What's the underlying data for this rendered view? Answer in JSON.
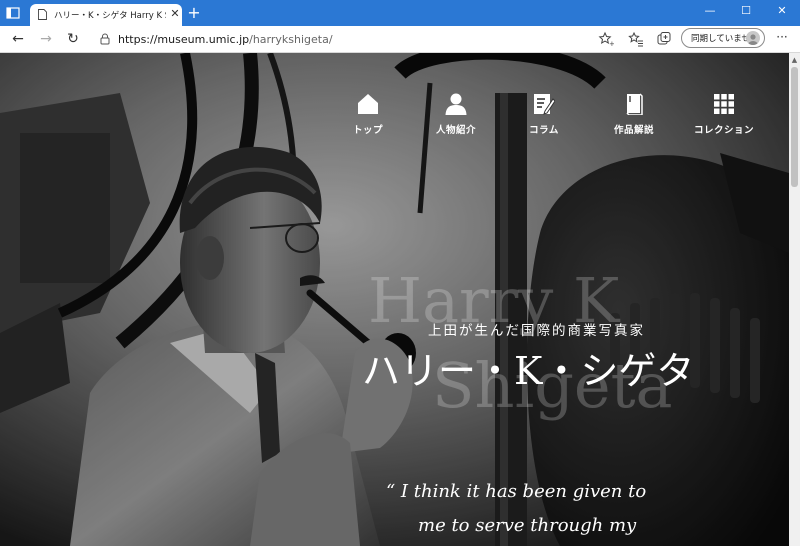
{
  "browser": {
    "tab_title": "ハリー・K・シゲタ Harry K Shigeta 上",
    "url_host": "https://museum.umic.jp",
    "url_path": "/harrykshigeta/",
    "sync_label": "同期していません"
  },
  "nav": {
    "items": [
      {
        "label": "トップ",
        "icon": "home-icon"
      },
      {
        "label": "人物紹介",
        "icon": "person-icon"
      },
      {
        "label": "コラム",
        "icon": "edit-icon"
      },
      {
        "label": "作品解説",
        "icon": "book-icon"
      },
      {
        "label": "コレクション",
        "icon": "grid-icon"
      }
    ]
  },
  "hero": {
    "ghost_line1": "Harry K",
    "ghost_line2": "Shigeta",
    "subtitle": "上田が生んだ国際的商業写真家",
    "title": "ハリー・K・シゲタ",
    "quote_line1": "“ I think it has been given to",
    "quote_line2": "me to serve through my"
  }
}
